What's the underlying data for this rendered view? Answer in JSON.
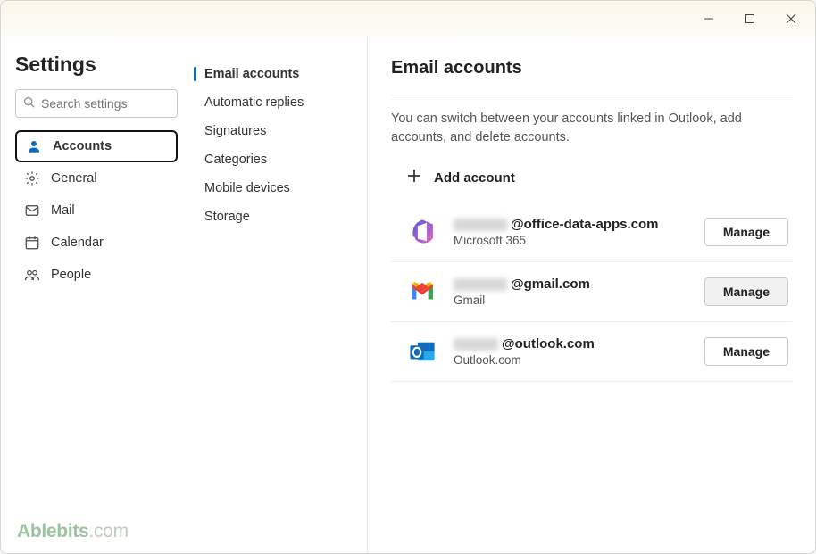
{
  "titlebar": {
    "minimize": "Minimize",
    "maximize": "Maximize",
    "close": "Close"
  },
  "sidebar": {
    "title": "Settings",
    "search_placeholder": "Search settings",
    "items": [
      {
        "id": "accounts",
        "label": "Accounts",
        "icon": "person",
        "selected": true
      },
      {
        "id": "general",
        "label": "General",
        "icon": "gear",
        "selected": false
      },
      {
        "id": "mail",
        "label": "Mail",
        "icon": "mail",
        "selected": false
      },
      {
        "id": "calendar",
        "label": "Calendar",
        "icon": "calendar",
        "selected": false
      },
      {
        "id": "people",
        "label": "People",
        "icon": "people",
        "selected": false
      }
    ]
  },
  "subnav": {
    "items": [
      {
        "id": "email-accounts",
        "label": "Email accounts",
        "active": true
      },
      {
        "id": "automatic-replies",
        "label": "Automatic replies",
        "active": false
      },
      {
        "id": "signatures",
        "label": "Signatures",
        "active": false
      },
      {
        "id": "categories",
        "label": "Categories",
        "active": false
      },
      {
        "id": "mobile-devices",
        "label": "Mobile devices",
        "active": false
      },
      {
        "id": "storage",
        "label": "Storage",
        "active": false
      }
    ]
  },
  "main": {
    "title": "Email accounts",
    "description": "You can switch between your accounts linked in Outlook, add accounts, and delete accounts.",
    "add_account_label": "Add account",
    "manage_label": "Manage",
    "accounts": [
      {
        "email_suffix": "@office-data-apps.com",
        "provider": "Microsoft 365",
        "icon": "m365",
        "blur_width": 60,
        "highlighted": false
      },
      {
        "email_suffix": "@gmail.com",
        "provider": "Gmail",
        "icon": "gmail",
        "blur_width": 60,
        "highlighted": true
      },
      {
        "email_suffix": "@outlook.com",
        "provider": "Outlook.com",
        "icon": "outlook",
        "blur_width": 50,
        "highlighted": false
      }
    ]
  },
  "watermark": {
    "text": "Ablebits",
    "suffix": ".com"
  }
}
